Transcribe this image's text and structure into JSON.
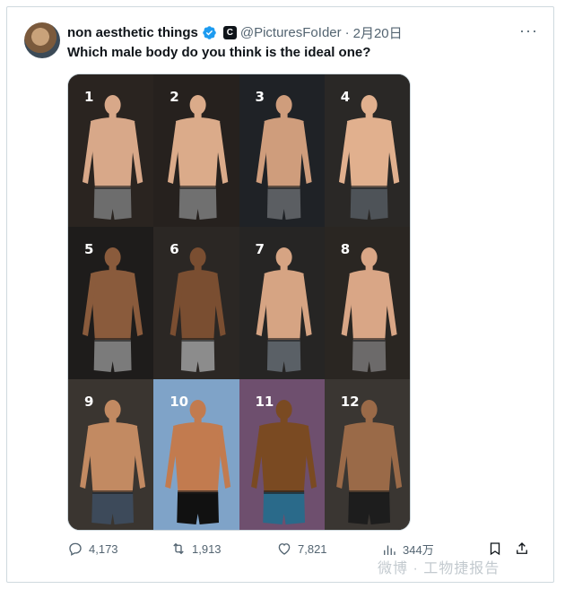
{
  "tweet": {
    "author_name": "non aesthetic things",
    "handle": "@PicturesFoIder",
    "separator": "·",
    "date": "2月20日",
    "org_badge": "C",
    "text": "Which male body do you think is the ideal one?",
    "more": "···"
  },
  "media": {
    "labels": [
      "1",
      "2",
      "3",
      "4",
      "5",
      "6",
      "7",
      "8",
      "9",
      "10",
      "11",
      "12"
    ],
    "colors": {
      "bg": [
        "#2a2420",
        "#26211e",
        "#1f2226",
        "#2a2826",
        "#1e1c1b",
        "#2b2724",
        "#262524",
        "#2a2622",
        "#3a3530",
        "#7fa3c8",
        "#6e4f6e",
        "#3a3632"
      ],
      "skin": [
        "#d8a889",
        "#dbab8a",
        "#cf9d7c",
        "#e1b08e",
        "#8a5b3c",
        "#7a4e31",
        "#d6a483",
        "#d9a686",
        "#c28a62",
        "#c27b4f",
        "#7a4a22",
        "#9a6a48"
      ],
      "shorts": [
        "#6d6d6d",
        "#707070",
        "#5b5e62",
        "#4e5358",
        "#7b7b7b",
        "#8c8c8c",
        "#5a6066",
        "#6c6a6a",
        "#3d4a5a",
        "#111111",
        "#2a6a8a",
        "#1d1d1d"
      ]
    }
  },
  "actions": {
    "replies": "4,173",
    "retweets": "1,913",
    "likes": "7,821",
    "views": "344万"
  },
  "watermark": "微博 · 工物捷报告",
  "colors": {
    "verified": "#1d9bf0",
    "muted": "#536471",
    "text": "#0f1419"
  }
}
